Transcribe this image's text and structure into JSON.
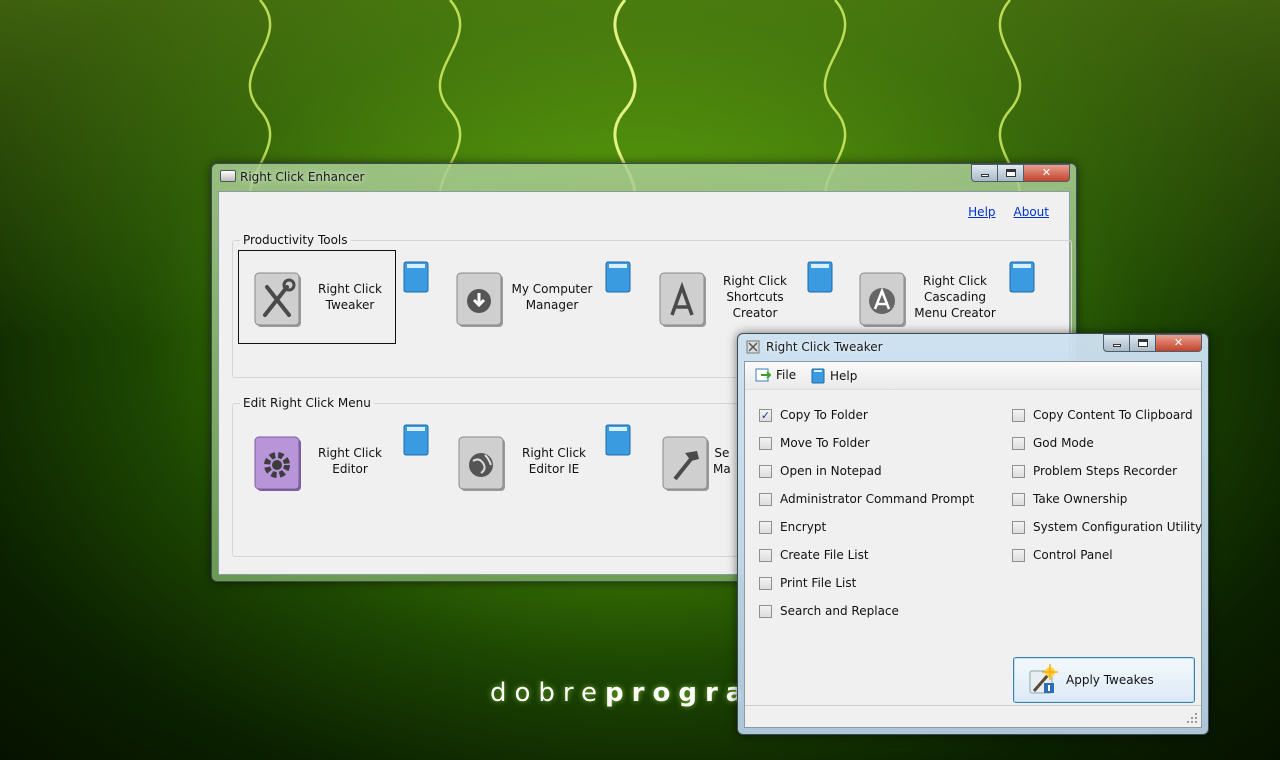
{
  "main_window": {
    "title": "Right Click Enhancer",
    "links": {
      "help": "Help",
      "about": "About"
    },
    "productivity_group": {
      "label": "Productivity Tools",
      "tools": [
        {
          "label": "Right Click Tweaker",
          "icon": "wrench-screwdriver-icon",
          "selected": true
        },
        {
          "label": "My Computer Manager",
          "icon": "drive-download-icon"
        },
        {
          "label": "Right Click Shortcuts Creator",
          "icon": "app-store-icon"
        },
        {
          "label": "Right Click Cascading Menu Creator",
          "icon": "app-store-circle-icon"
        }
      ]
    },
    "edit_group": {
      "label": "Edit Right Click Menu",
      "tools": [
        {
          "label": "Right Click Editor",
          "icon": "gear-icon"
        },
        {
          "label": "Right Click Editor IE",
          "icon": "globe-icon"
        },
        {
          "label": "Se\nMa",
          "icon": "hammer-icon"
        }
      ]
    }
  },
  "tweaker_window": {
    "title": "Right Click Tweaker",
    "menu": {
      "file": "File",
      "help": "Help"
    },
    "left_options": [
      {
        "label": "Copy To Folder",
        "checked": true
      },
      {
        "label": "Move To Folder",
        "checked": false
      },
      {
        "label": "Open in Notepad",
        "checked": false
      },
      {
        "label": "Administrator Command Prompt",
        "checked": false
      },
      {
        "label": "Encrypt",
        "checked": false
      },
      {
        "label": "Create File List",
        "checked": false
      },
      {
        "label": "Print File List",
        "checked": false
      },
      {
        "label": "Search and Replace",
        "checked": false
      }
    ],
    "right_options": [
      {
        "label": "Copy Content To Clipboard",
        "checked": false
      },
      {
        "label": "God Mode",
        "checked": false
      },
      {
        "label": "Problem Steps Recorder",
        "checked": false
      },
      {
        "label": "Take Ownership",
        "checked": false
      },
      {
        "label": "System Configuration Utility",
        "checked": false
      },
      {
        "label": "Control Panel",
        "checked": false
      }
    ],
    "apply_button": "Apply Tweakes"
  },
  "wallpaper": {
    "brand_light": "dobre",
    "brand_bold": "progra"
  },
  "colors": {
    "accent_link": "#0033cc",
    "wallpaper_green": "#3f7d05"
  }
}
